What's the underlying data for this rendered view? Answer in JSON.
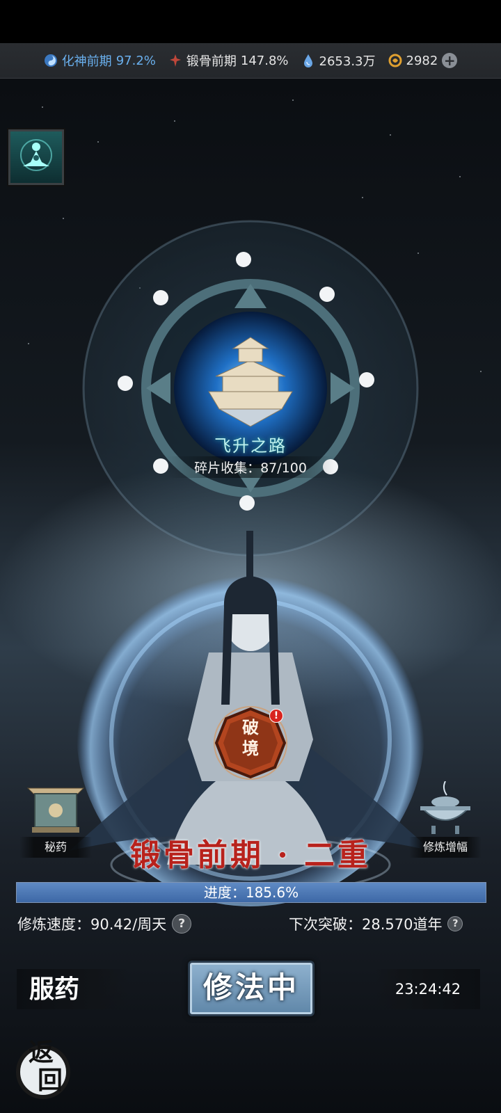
{
  "resources": {
    "soul_realm": "化神前期",
    "soul_pct": "97.2%",
    "bone_realm": "锻骨前期",
    "bone_pct": "147.8%",
    "spirit_stones": "2653.3万",
    "currency": "2982",
    "plus_symbol": "+"
  },
  "portal": {
    "title": "飞升之路",
    "fragments": "碎片收集：87/100"
  },
  "breakthrough": {
    "line1": "破",
    "line2": "境",
    "alert": "!"
  },
  "side": {
    "left_label": "秘药",
    "right_label": "修炼增幅"
  },
  "realm_title": "锻骨前期 · 二重",
  "progress": {
    "text": "进度：185.6%",
    "value": 1.0
  },
  "stats": {
    "speed": "修炼速度：90.42/周天",
    "next_break": "下次突破：28.570道年",
    "help": "?"
  },
  "actions": {
    "take_pill": "服药",
    "cultivate": "修法中",
    "timer": "23:24:42",
    "back_top": "返",
    "back_bottom": "回"
  },
  "colors": {
    "realm_red": "#b8221c",
    "accent_blue": "#6ab0ee",
    "portal_teal": "#bff2ef"
  }
}
